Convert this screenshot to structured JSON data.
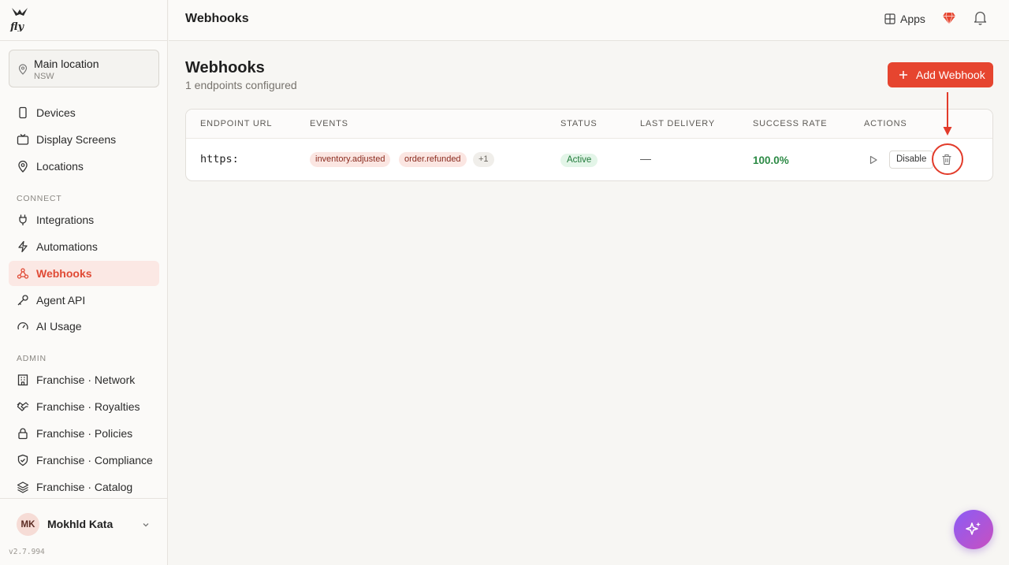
{
  "app": {
    "brand": "Fly",
    "version": "v2.7.994",
    "accent": "#e6452f"
  },
  "location": {
    "name": "Main location",
    "sub": "NSW"
  },
  "sidebar": {
    "items_top": [
      {
        "label": "Devices",
        "icon": "device-icon"
      },
      {
        "label": "Display Screens",
        "icon": "display-icon"
      },
      {
        "label": "Locations",
        "icon": "map-pin-icon"
      }
    ],
    "connect_label": "CONNECT",
    "items_connect": [
      {
        "label": "Integrations",
        "icon": "plug-icon"
      },
      {
        "label": "Automations",
        "icon": "lightning-icon"
      },
      {
        "label": "Webhooks",
        "icon": "webhook-icon",
        "active": true
      },
      {
        "label": "Agent API",
        "icon": "key-icon"
      },
      {
        "label": "AI Usage",
        "icon": "gauge-icon"
      }
    ],
    "admin_label": "ADMIN",
    "items_admin": [
      {
        "label": "Franchise · Network",
        "icon": "building-icon"
      },
      {
        "label": "Franchise · Royalties",
        "icon": "handshake-icon"
      },
      {
        "label": "Franchise · Policies",
        "icon": "lock-icon"
      },
      {
        "label": "Franchise · Compliance",
        "icon": "shield-check-icon"
      },
      {
        "label": "Franchise · Catalog",
        "icon": "layers-icon"
      }
    ]
  },
  "user": {
    "initials": "MK",
    "name": "Mokhld Kata"
  },
  "header": {
    "title": "Webhooks",
    "apps_label": "Apps"
  },
  "main": {
    "title": "Webhooks",
    "subtitle": "1 endpoints configured",
    "add_button": "Add Webhook",
    "table": {
      "columns": [
        "ENDPOINT URL",
        "EVENTS",
        "STATUS",
        "LAST DELIVERY",
        "SUCCESS RATE",
        "ACTIONS"
      ],
      "rows": [
        {
          "url": "https:",
          "events": [
            "inventory.adjusted",
            "order.refunded"
          ],
          "more_events": "+1",
          "status": "Active",
          "last_delivery": "—",
          "success_rate": "100.0%",
          "disable_label": "Disable"
        }
      ]
    }
  }
}
